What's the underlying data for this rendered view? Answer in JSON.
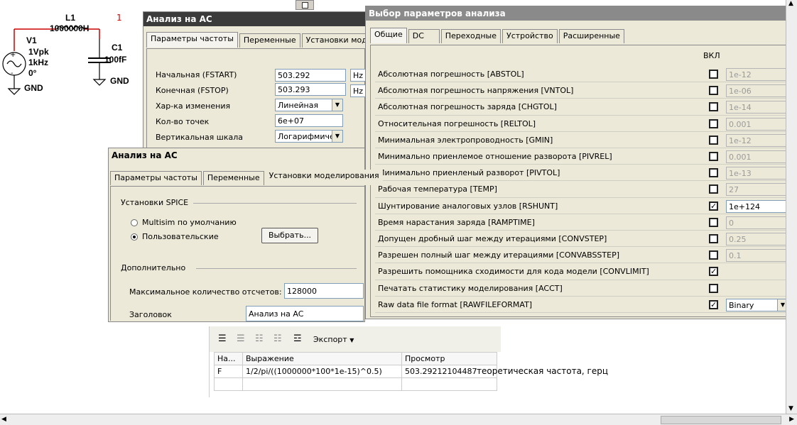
{
  "schematic": {
    "l1_name": "L1",
    "l1_value": "1000000H",
    "node_label": "1",
    "v1_name": "V1",
    "v1_amp": "1Vpk",
    "v1_freq": "1kHz",
    "v1_phase": "0°",
    "c1_name": "C1",
    "c1_value": "100fF",
    "gnd_left": "GND",
    "gnd_right": "GND"
  },
  "ac_top": {
    "title": "Анализ на AC",
    "tabs": [
      "Параметры частоты",
      "Переменные",
      "Установки моделиро"
    ],
    "fields": [
      {
        "label": "Начальная (FSTART)",
        "value": "503.292",
        "unit": "Hz"
      },
      {
        "label": "Конечная (FSTOP)",
        "value": "503.293",
        "unit": "Hz"
      },
      {
        "label": "Хар-ка изменения",
        "value": "Линейная"
      },
      {
        "label": "Кол-во точек",
        "value": "6e+07"
      },
      {
        "label": "Вертикальная шкала",
        "value": "Логарифмичес"
      }
    ]
  },
  "ac_mid": {
    "title": "Анализ на AC",
    "tabs": [
      "Параметры частоты",
      "Переменные",
      "Установки моделирования"
    ],
    "spice_group": "Установки SPICE",
    "radio_default": "Multisim по умолчанию",
    "radio_custom": "Пользовательские",
    "select_button": "Выбрать...",
    "extra_group": "Дополнительно",
    "max_points_label": "Максимальное количество отсчетов:",
    "max_points_value": "128000",
    "heading_label": "Заголовок",
    "heading_value": "Анализ на AC"
  },
  "params": {
    "title": "Выбор параметров анализа",
    "tabs": [
      "Общие",
      "DC",
      "Переходные",
      "Устройство",
      "Расширенные"
    ],
    "enabled_header": "ВКЛ",
    "rows": [
      {
        "label": "Абсолютная погрешность [ABSTOL]",
        "checked": false,
        "value": "1e-12"
      },
      {
        "label": "Абсолютная погрешность напряжения [VNTOL]",
        "checked": false,
        "value": "1e-06"
      },
      {
        "label": "Абсолютная погрешность заряда [CHGTOL]",
        "checked": false,
        "value": "1e-14"
      },
      {
        "label": "Относительная погрешность [RELTOL]",
        "checked": false,
        "value": "0.001"
      },
      {
        "label": "Минимальная электропроводность [GMIN]",
        "checked": false,
        "value": "1e-12"
      },
      {
        "label": "Минимально приенлемое отношение разворота [PIVREL]",
        "checked": false,
        "value": "0.001"
      },
      {
        "label": "Минимально приенленый разворот [PIVTOL]",
        "checked": false,
        "value": "1e-13"
      },
      {
        "label": "Рабочая температура [TEMP]",
        "checked": false,
        "value": "27"
      },
      {
        "label": "Шунтирование аналоговых узлов [RSHUNT]",
        "checked": true,
        "value": "1e+124"
      },
      {
        "label": "Время нарастания заряда [RAMPTIME]",
        "checked": false,
        "value": "0"
      },
      {
        "label": "Допущен дробный шаг между итерациями [CONVSTEP]",
        "checked": false,
        "value": "0.25"
      },
      {
        "label": "Разрешен полный шаг между итерациями [CONVABSSTEP]",
        "checked": false,
        "value": "0.1"
      },
      {
        "label": "Разрешить помощника сходимости для кода модели [CONVLIMIT]",
        "checked": true,
        "value": ""
      },
      {
        "label": "Печатать статистику моделирования [ACCT]",
        "checked": false,
        "value": ""
      },
      {
        "label": "Raw data file format [RAWFILEFORMAT]",
        "checked": true,
        "value": "Binary"
      }
    ]
  },
  "expr": {
    "export_label": "Экспорт",
    "col_name": "На...",
    "col_expr": "Выражение",
    "col_view": "Просмотр",
    "row_name": "F",
    "row_expr": "1/2/pi/((1000000*100*1e-15)^0.5)",
    "row_view": "503.29212104487",
    "note": "теоретическая частота, герц"
  }
}
